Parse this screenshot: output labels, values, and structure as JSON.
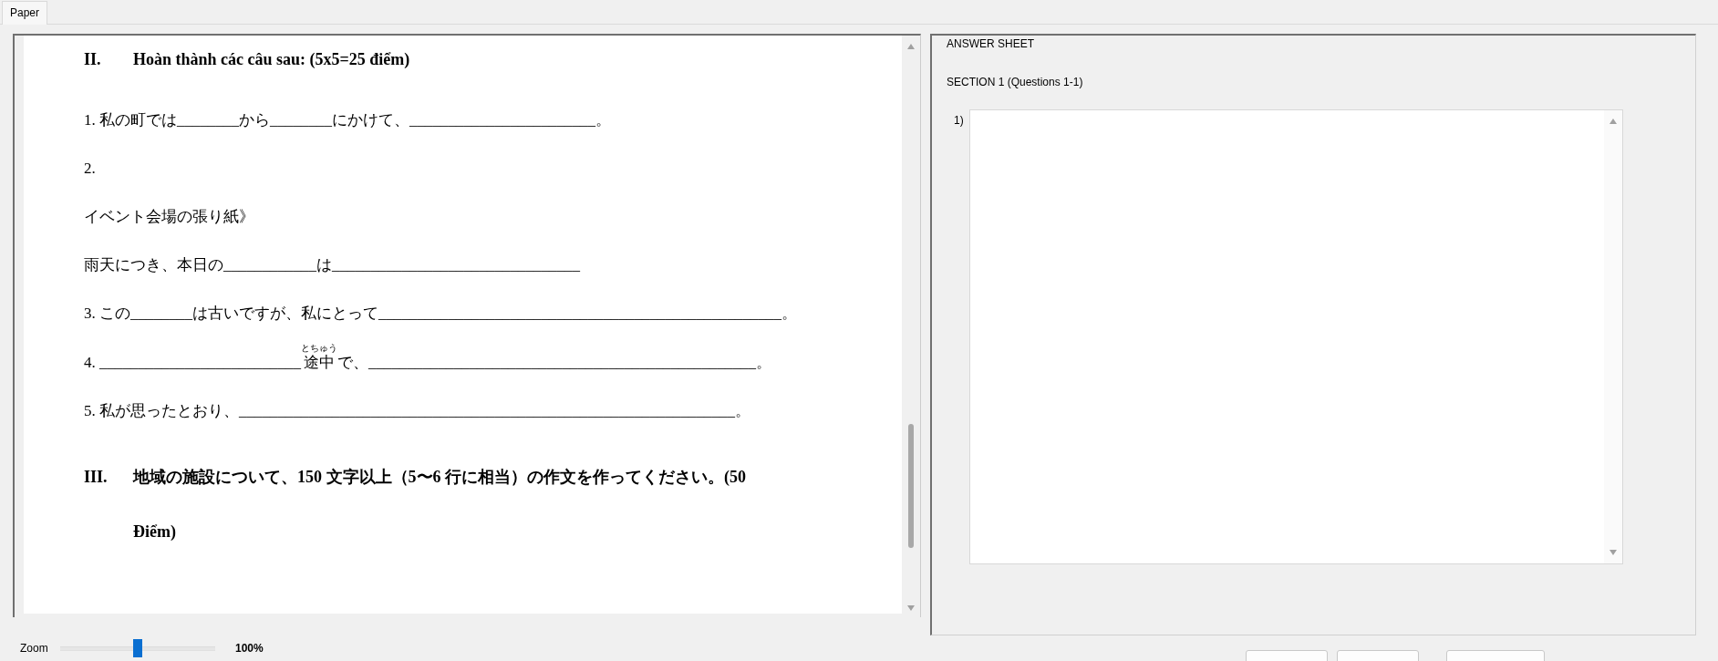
{
  "tabs": [
    {
      "label": "Paper",
      "selected": true
    }
  ],
  "paper": {
    "lines": [
      {
        "kind": "heading",
        "number": "II.",
        "text": "Hoàn thành các câu sau:    (5x5=25 điểm)"
      },
      {
        "kind": "line",
        "text": "1. 私の町では________から________にかけて、________________________。"
      },
      {
        "kind": "line",
        "text": "2."
      },
      {
        "kind": "line",
        "text": "イベント会場の張り紙》"
      },
      {
        "kind": "line",
        "text": "雨天につき、本日の____________は________________________________"
      },
      {
        "kind": "line",
        "text": "3. この________は古いですが、私にとって____________________________________________________。"
      },
      {
        "kind": "ruby",
        "before": "4.     __________________________",
        "base": "途中",
        "reading": "とちゅう",
        "after": "で、__________________________________________________。"
      },
      {
        "kind": "line",
        "text": "5. 私が思ったとおり、________________________________________________________________。"
      },
      {
        "kind": "heading",
        "number": "III.",
        "text": "地域の施設について、150 文字以上（5〜6 行に相当）の作文を作ってください。(50 Điểm)"
      }
    ]
  },
  "answer_sheet": {
    "title": "ANSWER SHEET",
    "section": "SECTION 1 (Questions 1-1)",
    "questions": [
      {
        "label": "1)"
      }
    ]
  },
  "zoom": {
    "label": "Zoom",
    "level": 0.5,
    "reading": "100%"
  }
}
